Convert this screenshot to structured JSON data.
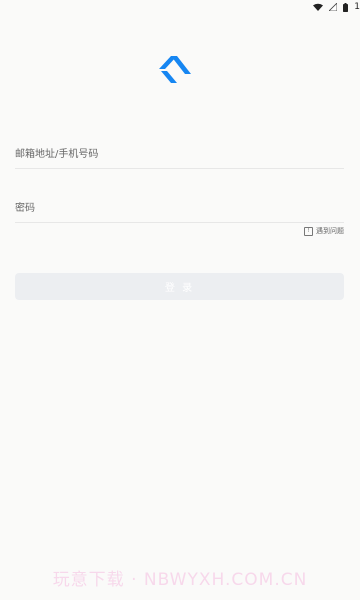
{
  "status_bar": {
    "icons": [
      "wifi-icon",
      "signal-icon",
      "battery-icon"
    ],
    "time_partial": "1"
  },
  "branding": {
    "logo": "logo-icon",
    "accent_color": "#1686f2"
  },
  "login_form": {
    "account_placeholder": "邮箱地址/手机号码",
    "account_value": "",
    "password_placeholder": "密码",
    "password_value": "",
    "help_label": "遇到问题",
    "help_icon": "help-icon",
    "submit_label": "登 录"
  },
  "watermark": {
    "text": "玩意下载 · NBWYXH.COM.CN"
  }
}
